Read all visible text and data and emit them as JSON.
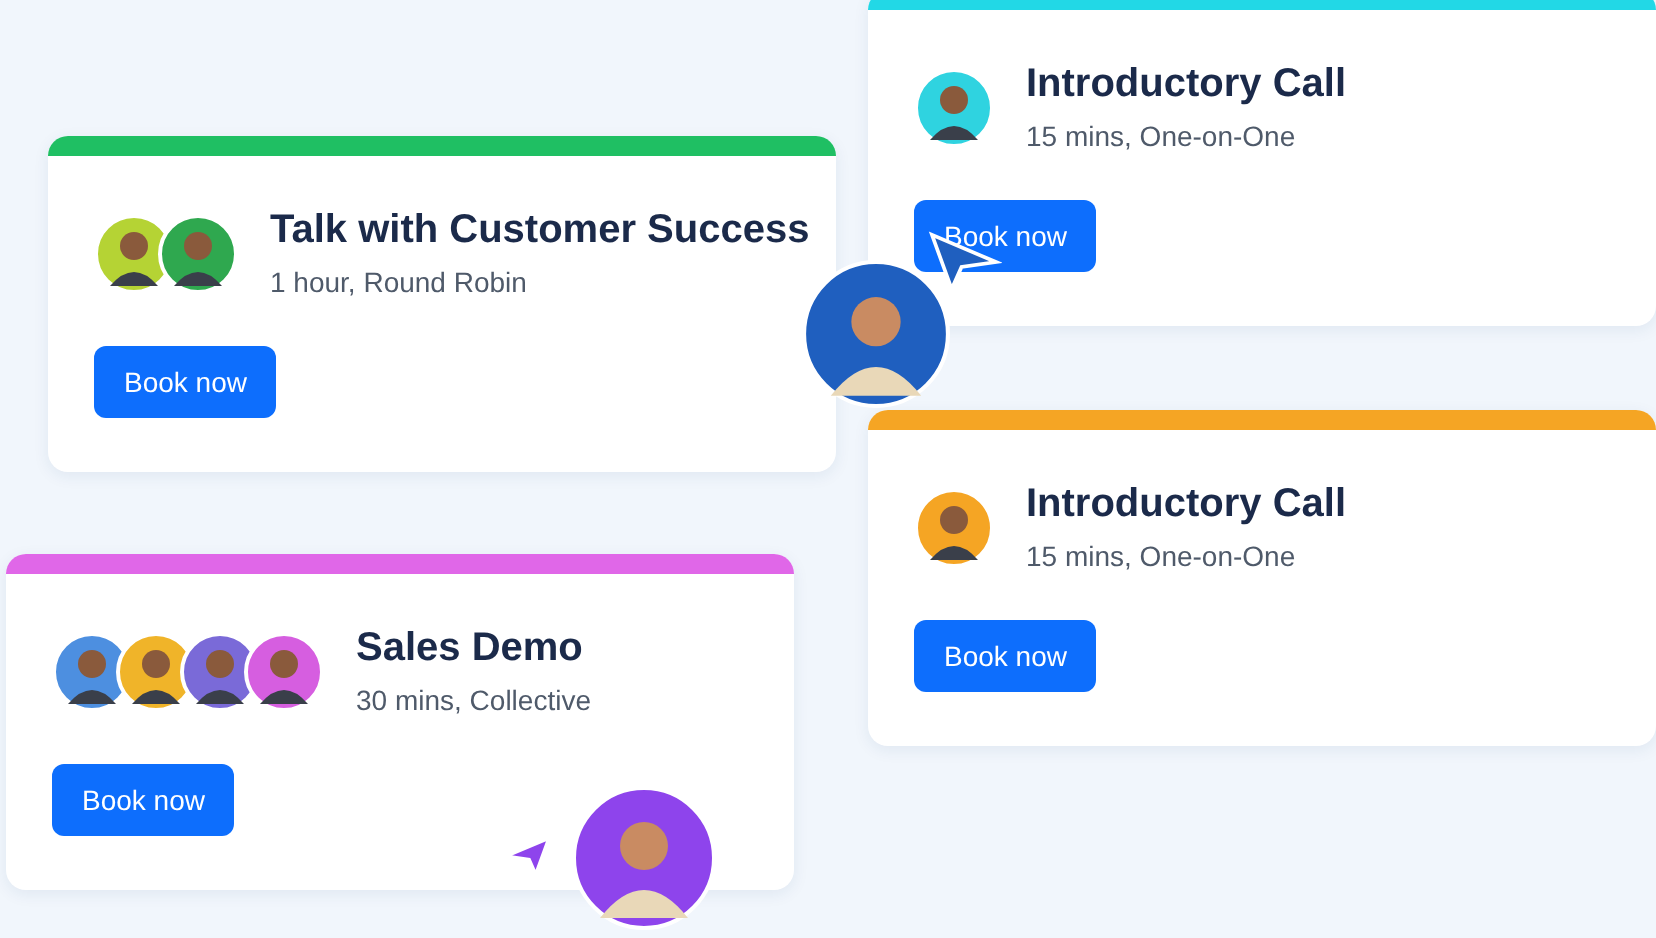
{
  "cards": [
    {
      "title": "Talk with Customer Success",
      "subtitle": "1 hour, Round Robin",
      "button": "Book now",
      "color": "#1fbf63",
      "avatars": [
        {
          "color": "#b5d334"
        },
        {
          "color": "#2fa84f"
        }
      ]
    },
    {
      "title": "Introductory Call",
      "subtitle": "15 mins, One-on-One",
      "button": "Book now",
      "color": "#22d8e6",
      "avatars": [
        {
          "color": "#2fd3e0"
        }
      ]
    },
    {
      "title": "Introductory Call",
      "subtitle": "15 mins, One-on-One",
      "button": "Book now",
      "color": "#f5a524",
      "avatars": [
        {
          "color": "#f5a524"
        }
      ]
    },
    {
      "title": "Sales Demo",
      "subtitle": "30 mins, Collective",
      "button": "Book now",
      "color": "#e067e8",
      "avatars": [
        {
          "color": "#4d8fe0"
        },
        {
          "color": "#f0b429"
        },
        {
          "color": "#7a6ad8"
        },
        {
          "color": "#d65ee0"
        }
      ]
    }
  ],
  "pointers": [
    {
      "color": "#1f5fbf"
    },
    {
      "color": "#8e44ec"
    }
  ]
}
